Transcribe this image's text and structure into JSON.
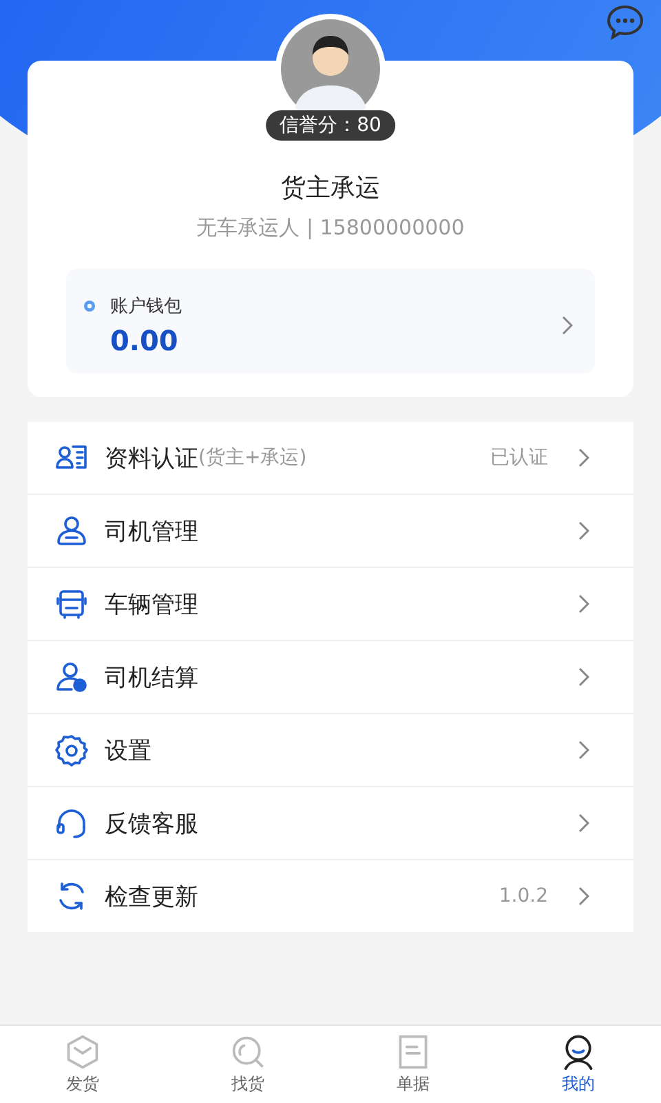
{
  "profile": {
    "credit_badge": "信誉分：80",
    "name": "货主承运",
    "subtitle": "无车承运人 | 15800000000"
  },
  "wallet": {
    "label": "账户钱包",
    "amount": "0.00"
  },
  "menu": [
    {
      "kind": "id",
      "label": "资料认证",
      "note": "(货主+承运)",
      "value": "已认证"
    },
    {
      "kind": "driver",
      "label": "司机管理"
    },
    {
      "kind": "bus",
      "label": "车辆管理"
    },
    {
      "kind": "settle",
      "label": "司机结算"
    },
    {
      "kind": "gear",
      "label": "设置"
    },
    {
      "kind": "headset",
      "label": "反馈客服"
    },
    {
      "kind": "refresh",
      "label": "检查更新",
      "value": "1.0.2"
    }
  ],
  "tabs": [
    {
      "kind": "box",
      "label": "发货",
      "selected": false
    },
    {
      "kind": "search",
      "label": "找货",
      "selected": false
    },
    {
      "kind": "doc",
      "label": "单据",
      "selected": false
    },
    {
      "kind": "user",
      "label": "我的",
      "selected": true
    }
  ]
}
